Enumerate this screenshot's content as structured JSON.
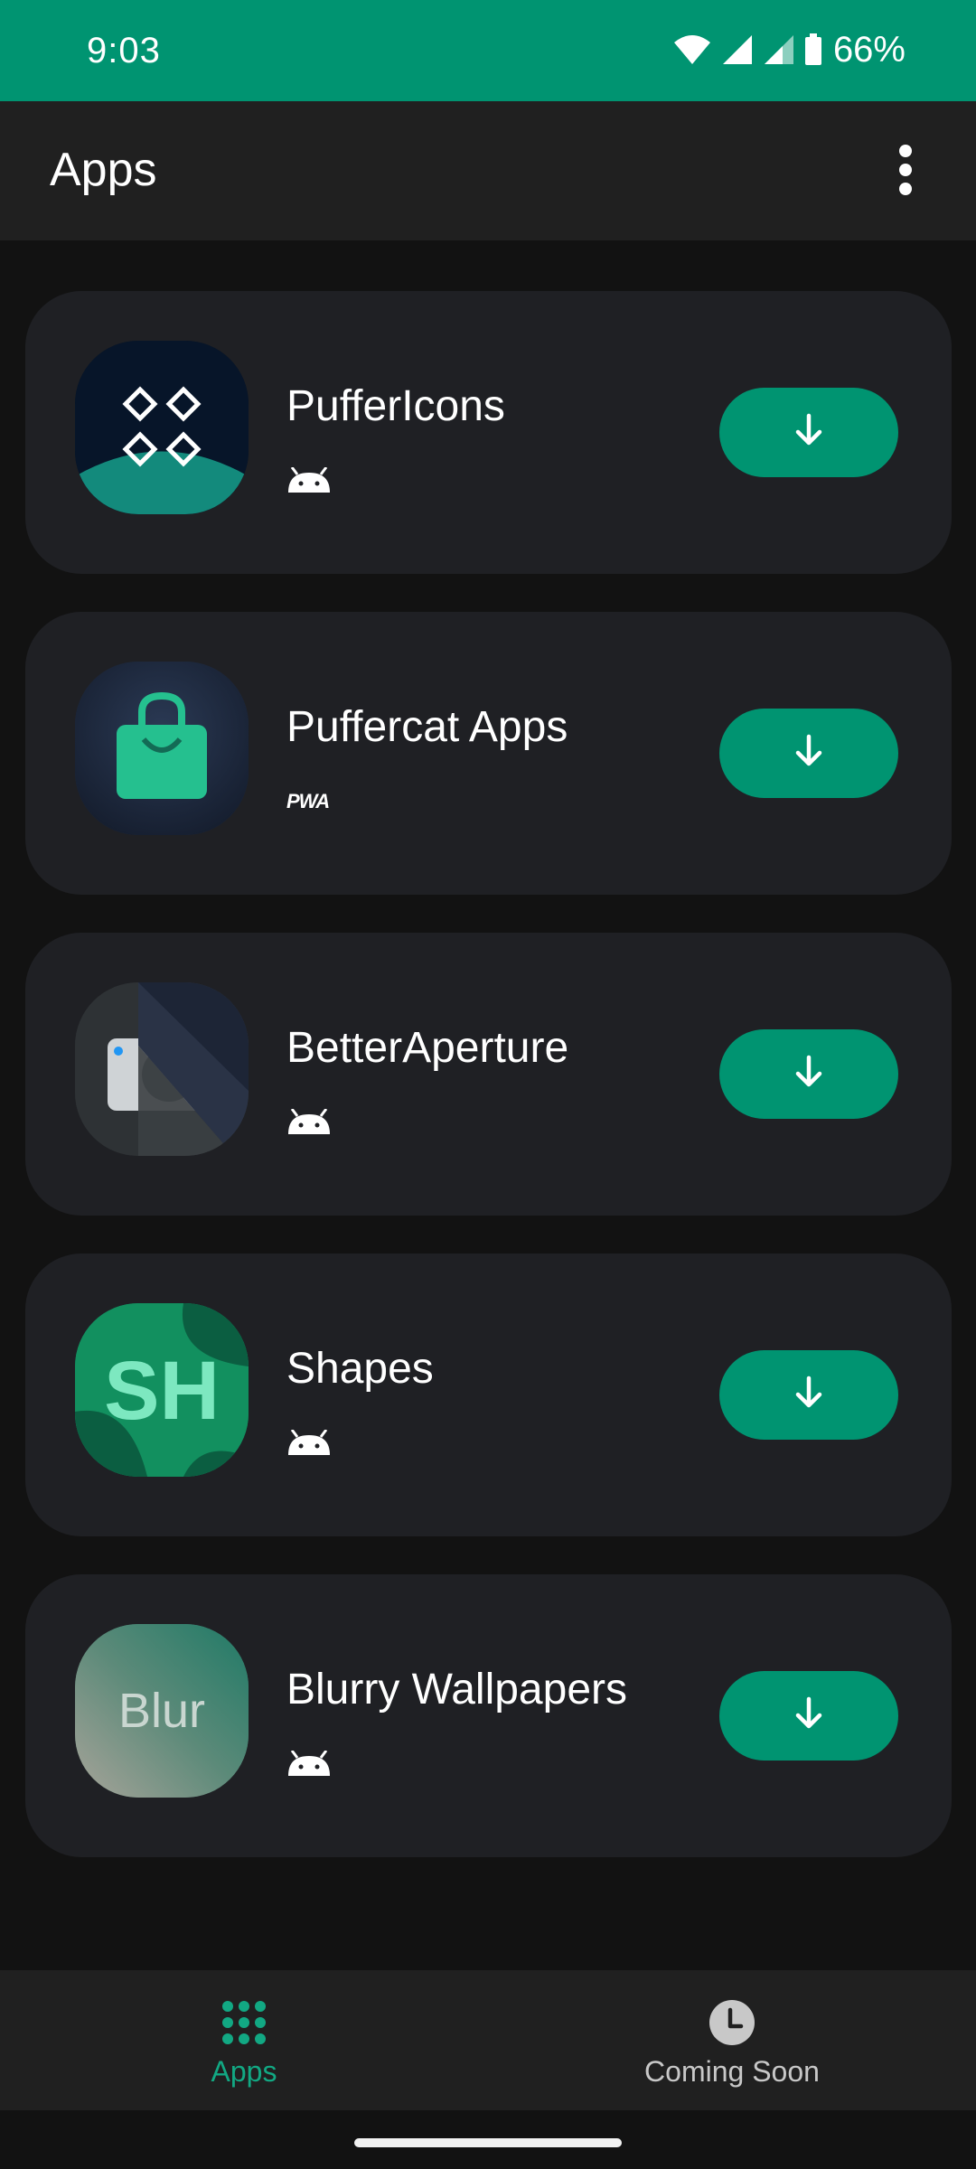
{
  "status_bar": {
    "time": "9:03",
    "battery_percent": "66%",
    "background": "#009471"
  },
  "app_bar": {
    "title": "Apps",
    "menu_icon": "more-vert-icon"
  },
  "apps": [
    {
      "name": "PufferIcons",
      "platform": "android"
    },
    {
      "name": "Puffercat Apps",
      "platform": "pwa",
      "platform_label": "PWA"
    },
    {
      "name": "BetterAperture",
      "platform": "android"
    },
    {
      "name": "Shapes",
      "platform": "android",
      "icon_text": "SH"
    },
    {
      "name": "Blurry Wallpapers",
      "platform": "android",
      "icon_text": "Blur"
    }
  ],
  "download_icon": "arrow-down-icon",
  "bottom_nav": {
    "items": [
      {
        "label": "Apps",
        "icon": "grid-dots-icon",
        "active": true
      },
      {
        "label": "Coming Soon",
        "icon": "clock-icon",
        "active": false
      }
    ]
  },
  "colors": {
    "accent": "#009471",
    "accent_text": "#12a883",
    "card": "#1f2024",
    "background": "#121212",
    "bar": "#202020"
  }
}
